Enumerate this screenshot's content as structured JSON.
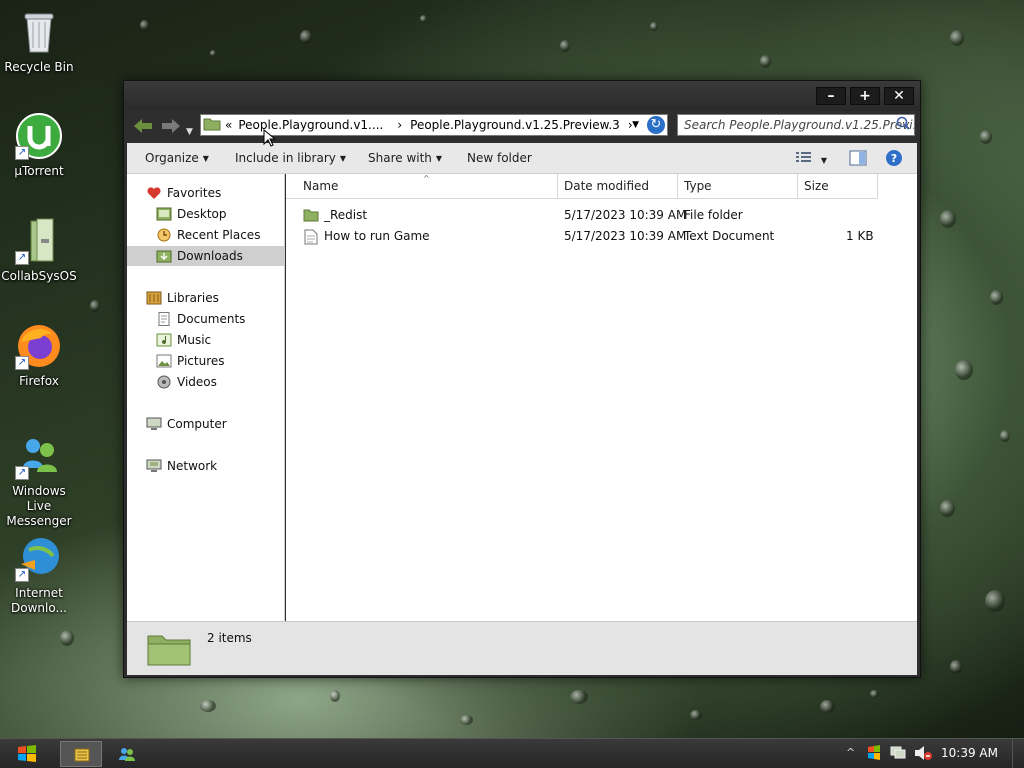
{
  "desktop": {
    "icons": [
      {
        "label": "Recycle Bin",
        "icon": "recycle-bin-icon"
      },
      {
        "label": "µTorrent",
        "icon": "utorrent-icon"
      },
      {
        "label": "CollabSysOS",
        "icon": "collabsysos-icon"
      },
      {
        "label": "Firefox",
        "icon": "firefox-icon"
      },
      {
        "label": "Windows Live Messenger",
        "icon": "messenger-icon"
      },
      {
        "label": "Internet Downlo...",
        "icon": "idm-icon"
      }
    ]
  },
  "window": {
    "buttons": {
      "minimize": "–",
      "maximize": "+",
      "close": "✕"
    },
    "address": {
      "overflow": "«",
      "segments": [
        "People.Playground.v1....",
        "People.Playground.v1.25.Preview.3"
      ],
      "separator": "›"
    },
    "search_placeholder": "Search People.Playground.v1.25.Previ...",
    "toolbar": {
      "organize": "Organize",
      "include_in_library": "Include in library",
      "share_with": "Share with",
      "new_folder": "New folder"
    },
    "nav": {
      "favorites": "Favorites",
      "desktop": "Desktop",
      "recent_places": "Recent Places",
      "downloads": "Downloads",
      "libraries": "Libraries",
      "documents": "Documents",
      "music": "Music",
      "pictures": "Pictures",
      "videos": "Videos",
      "computer": "Computer",
      "network": "Network"
    },
    "columns": {
      "name": "Name",
      "date": "Date modified",
      "type": "Type",
      "size": "Size"
    },
    "files": [
      {
        "name": "_Redist",
        "date": "5/17/2023 10:39 AM",
        "type": "File folder",
        "size": ""
      },
      {
        "name": "How to run Game",
        "date": "5/17/2023 10:39 AM",
        "type": "Text Document",
        "size": "1 KB"
      }
    ],
    "status": {
      "item_count": "2 items"
    }
  },
  "taskbar": {
    "clock": "10:39 AM"
  },
  "colors": {
    "accent_green": "#6b8f3d",
    "folder_green": "#8fb060",
    "selection": "#cfcfcf"
  }
}
